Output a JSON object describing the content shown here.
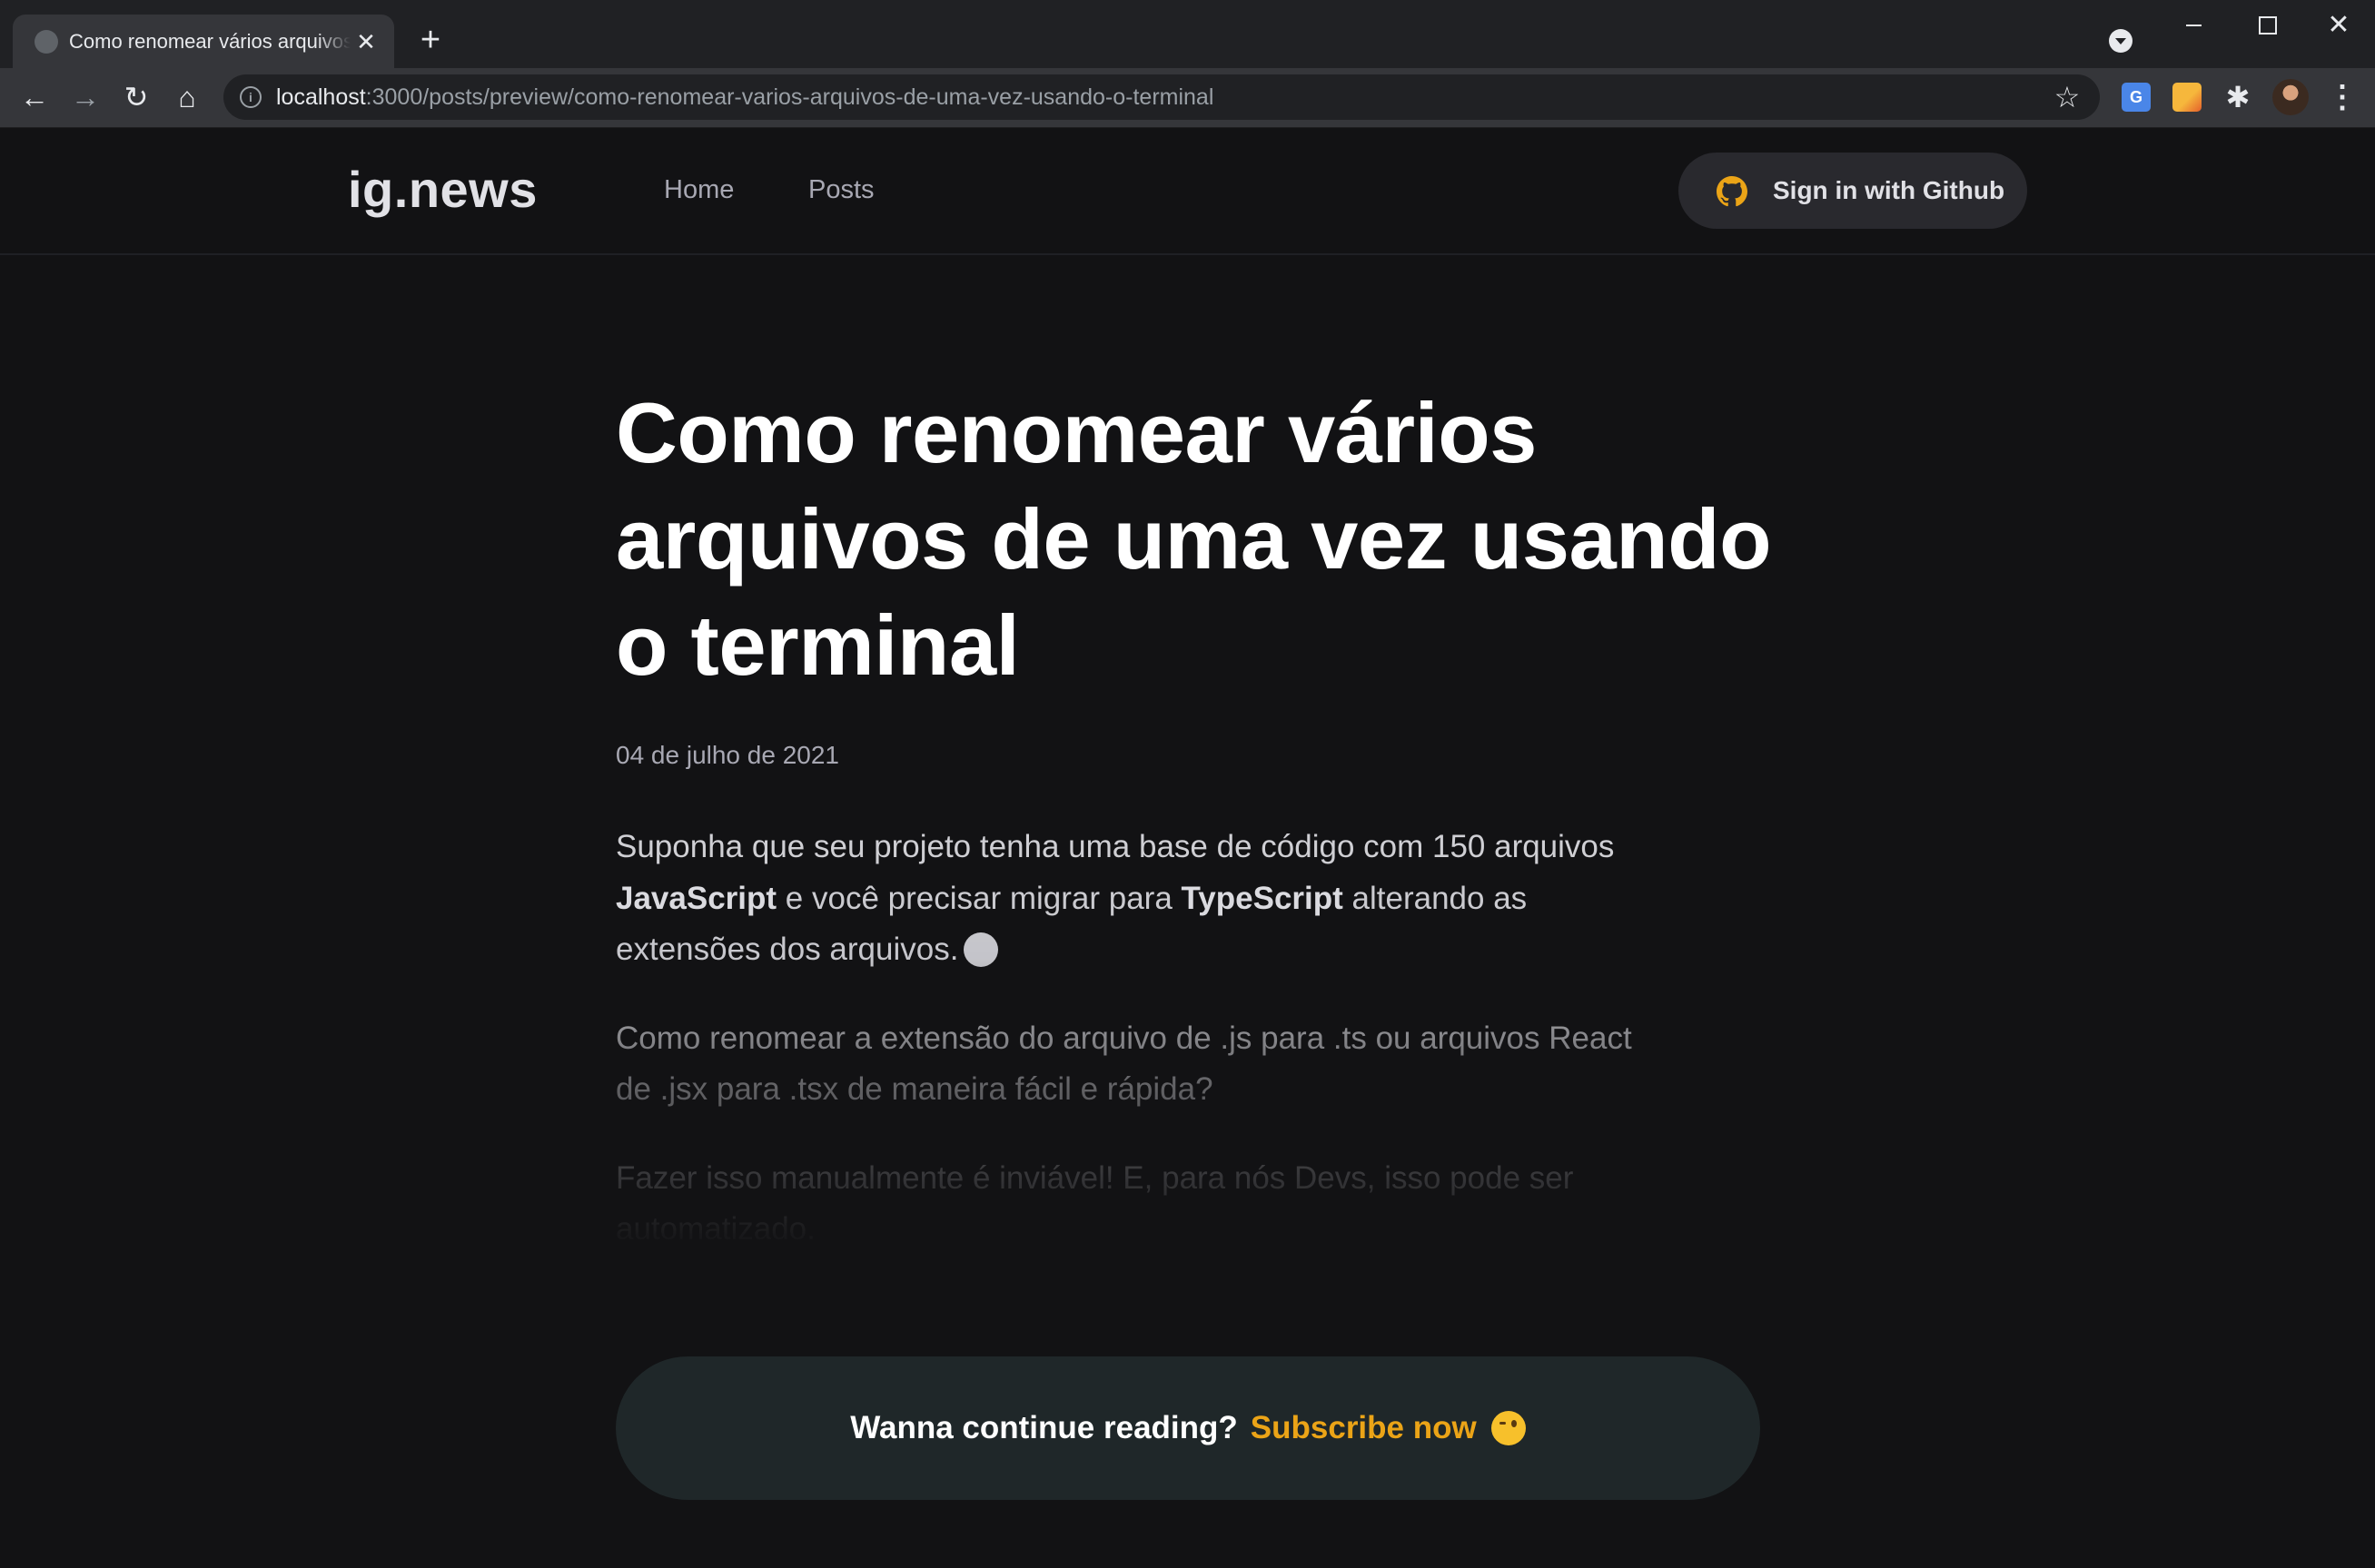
{
  "browser": {
    "tab_title": "Como renomear vários arquivos de uma vez usando o terminal",
    "tab_close_glyph": "✕",
    "new_tab_glyph": "+",
    "url_host": "localhost",
    "url_rest": ":3000/posts/preview/como-renomear-varios-arquivos-de-uma-vez-usando-o-terminal",
    "icons": {
      "back": "←",
      "forward": "→",
      "reload": "↻",
      "home": "⌂",
      "info": "i",
      "star": "☆",
      "puzzle": "✱",
      "menu": "⋮",
      "close": "✕"
    }
  },
  "header": {
    "logo": "ig.news",
    "nav": [
      "Home",
      "Posts"
    ],
    "signin_label": "Sign in with Github",
    "github_icon_color": "#eba417"
  },
  "post": {
    "title": "Como renomear vários arquivos de uma vez usando o terminal",
    "date": "04 de julho de 2021",
    "p1": {
      "t1": "Suponha que seu projeto tenha uma base de código com 150 arquivos ",
      "b1": "JavaScript",
      "t2": " e você precisar migrar para ",
      "b2": "TypeScript",
      "t3": " alterando as extensões dos arquivos."
    },
    "p2": "Como renomear a extensão do arquivo de .js para .ts ou arquivos React de .jsx para .tsx de maneira fácil e rápida?",
    "p3": "Fazer isso manualmente é inviável! E, para nós Devs, isso pode ser automatizado."
  },
  "cta": {
    "text": "Wanna continue reading?",
    "link": "Subscribe now",
    "link_color": "#eba417"
  },
  "colors": {
    "background": "#121214",
    "accent": "#eba417",
    "cta_background": "#1f2729"
  }
}
